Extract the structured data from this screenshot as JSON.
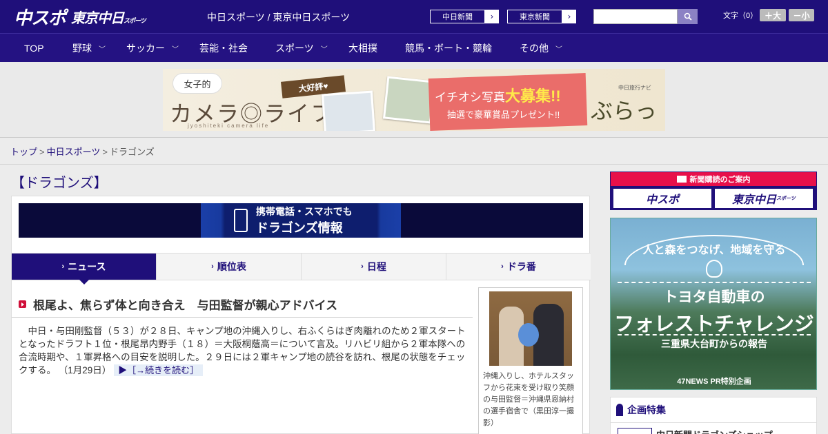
{
  "header": {
    "logo_main": "中スポ",
    "logo_sub": "東京中日",
    "logo_sub_small": "スポーツ",
    "site_title": "中日スポーツ / 東京中日スポーツ",
    "links": [
      {
        "label": "中日新聞",
        "arrow": "›"
      },
      {
        "label": "東京新聞",
        "arrow": "›"
      }
    ],
    "search_placeholder": "",
    "font_size_label": "文字（0）",
    "font_larger": "＋大",
    "font_smaller": "－小"
  },
  "nav": {
    "items": [
      {
        "label": "TOP",
        "has_menu": false
      },
      {
        "label": "野球",
        "has_menu": true
      },
      {
        "label": "サッカー",
        "has_menu": true
      },
      {
        "label": "芸能・社会",
        "has_menu": false
      },
      {
        "label": "スポーツ",
        "has_menu": true
      },
      {
        "label": "大相撲",
        "has_menu": false
      },
      {
        "label": "競馬・ボート・競輪",
        "has_menu": false
      },
      {
        "label": "その他",
        "has_menu": true
      }
    ],
    "chevron": "﹀"
  },
  "banner": {
    "bubble": "女子的",
    "title": "カメラ◎ライフ",
    "subtitle": "jyoshiteki camera life",
    "tag": "大好評♥",
    "promo_pre": "イチオシ写真",
    "promo_big": "大募集!!",
    "promo_sub": "抽選で豪華賞品プレゼント!!",
    "brand_small": "中日旅行ナビ",
    "brand": "ぶらっ人"
  },
  "breadcrumb": {
    "items": [
      "トップ",
      "中日スポーツ"
    ],
    "current": "ドラゴンズ",
    "separator": ">"
  },
  "page": {
    "title": "【ドラゴンズ】"
  },
  "mobile_banner": {
    "line1": "携帯電話・スマホでも",
    "line2": "ドラゴンズ情報"
  },
  "tabs": [
    {
      "label": "ニュース",
      "active": true
    },
    {
      "label": "順位表",
      "active": false
    },
    {
      "label": "日程",
      "active": false
    },
    {
      "label": "ドラ番",
      "active": false
    }
  ],
  "tab_chevron": "›",
  "article": {
    "title": "根尾よ、焦らず体と向き合え　与田監督が親心アドバイス",
    "body": "　中日・与田剛監督（５３）が２８日、キャンプ地の沖縄入りし、右ふくらはぎ肉離れのため２軍スタートとなったドラフト１位・根尾昂内野手（１８）＝大阪桐蔭高＝について言及。リハビリ組から２軍本隊への合流時期や、１軍昇格への目安を説明した。２９日には２軍キャンプ地の読谷を訪れ、根尾の状態をチェックする。",
    "date": "（1月29日）",
    "read_more": "▶［→続きを読む］",
    "photo_caption": "沖縄入りし、ホテルスタッフから花束を受け取り笑顔の与田監督＝沖縄県恩納村の選手宿舎で（黒田淳一撮影）"
  },
  "sidebar": {
    "subscription_head": "新聞購読のご案内",
    "sub_buttons": [
      {
        "label": "中スポ",
        "small": ""
      },
      {
        "label": "東京中日",
        "small": "スポーツ"
      }
    ],
    "ad": {
      "line1": "人と森をつなげ、地域を守る",
      "line2": "トヨタ自動車の",
      "line3": "フォレストチャレンジ",
      "line4": "三重県大台町からの報告",
      "footer": "47NEWS PR特別企画"
    },
    "feature_title": "企画特集",
    "feature_item": "中日新聞ドラゴンズショップ"
  },
  "colors": {
    "brand_navy": "#1f0f7a",
    "accent_red": "#e8104a"
  }
}
